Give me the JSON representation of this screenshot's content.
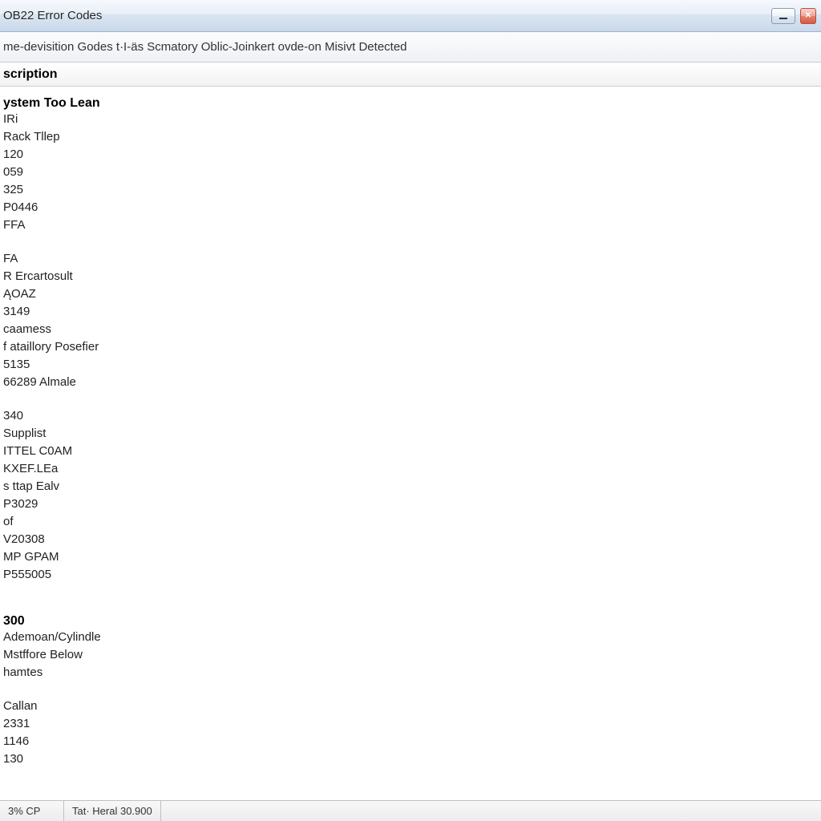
{
  "window": {
    "title": "OB22 Error Codes"
  },
  "toolbar": {
    "text": "me-devisition Godes t·I-äs Scmatory Oblic-Joinkert ovde-on Misivt Detected"
  },
  "column_header": "scription",
  "groups": [
    {
      "title": "ystem Too Lean",
      "items": [
        "IRi",
        "Rack Tllep",
        "120",
        "059",
        "325",
        "P0446",
        "FFA"
      ]
    },
    {
      "title": "",
      "items": [
        "FA",
        "R Ercartosult",
        "ĄOAZ",
        "3149",
        "caamess",
        "f ataillory Posefier",
        "5135",
        "66289 Almale"
      ]
    },
    {
      "title": "",
      "items": [
        "340",
        "Supplist",
        "ITTEL C0AM",
        "KXEF.LEa",
        "s ttap Ealv",
        "P3029",
        "of",
        "V20308",
        "MP GPAM",
        "P555005"
      ]
    },
    {
      "title": "300",
      "items": [
        "Ademoan/Cylindle",
        "Mstffore Below",
        "hamtes"
      ]
    },
    {
      "title": "",
      "items": [
        "Callan",
        "2331",
        "1146",
        "130"
      ]
    }
  ],
  "statusbar": {
    "cell1": "3% CP",
    "cell2": "Tat· Heral 30.900"
  }
}
